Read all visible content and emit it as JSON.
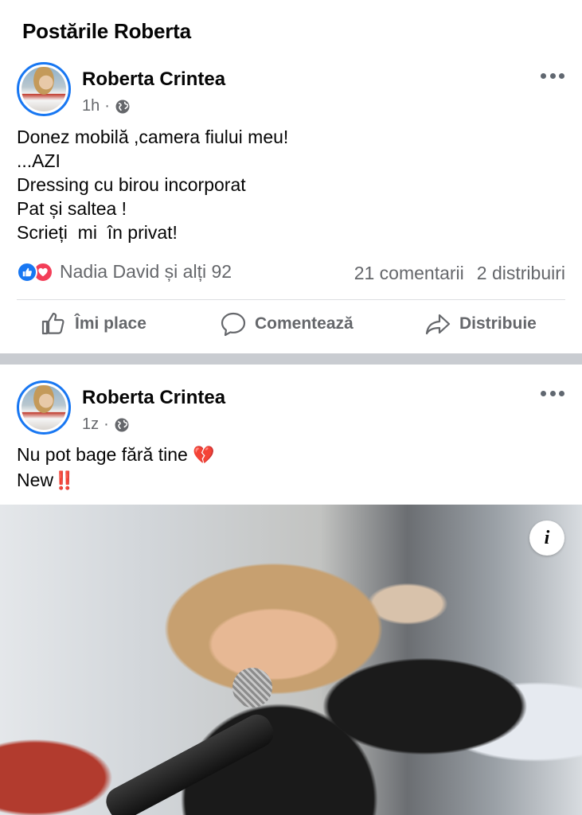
{
  "page": {
    "title": "Postările Roberta"
  },
  "posts": [
    {
      "author": "Roberta Crintea",
      "time": "1h",
      "separator": "·",
      "lines": [
        "Donez mobilă ,camera fiului meu!",
        "...AZI",
        "Dressing cu birou incorporat",
        "Pat și saltea !",
        "Scrieți  mi  în privat!"
      ],
      "reactions_text": "Nadia David și alți 92",
      "comments": "21 comentarii",
      "shares": "2 distribuiri",
      "actions": {
        "like": "Îmi place",
        "comment": "Comentează",
        "share": "Distribuie"
      }
    },
    {
      "author": "Roberta Crintea",
      "time": "1z",
      "separator": "·",
      "line1": "Nu pot bage fără tine",
      "line1_emoji": "💔",
      "line2": "New",
      "line2_emoji": "‼️",
      "info_label": "i"
    }
  ],
  "icons": {
    "globe": "globe-icon",
    "more": "more-options-icon",
    "like_reaction": "like-reaction-icon",
    "love_reaction": "love-reaction-icon",
    "like": "thumbs-up-icon",
    "comment": "speech-bubble-icon",
    "share": "share-arrow-icon",
    "info": "info-icon"
  },
  "colors": {
    "accent": "#1877f2",
    "love": "#f33e58",
    "secondary_text": "#65676b",
    "separator": "#c9ccd1"
  }
}
